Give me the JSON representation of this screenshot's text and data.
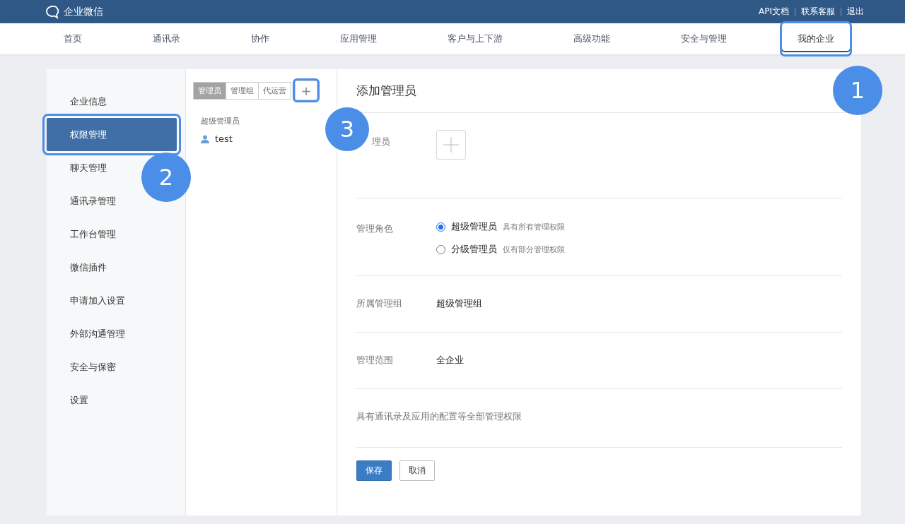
{
  "header": {
    "logo": "企业微信",
    "links": [
      "API文档",
      "联系客服",
      "退出"
    ]
  },
  "nav": [
    {
      "label": "首页",
      "selected": false,
      "highlighted": false
    },
    {
      "label": "通讯录",
      "selected": false,
      "highlighted": false
    },
    {
      "label": "协作",
      "selected": false,
      "highlighted": false
    },
    {
      "label": "应用管理",
      "selected": false,
      "highlighted": false
    },
    {
      "label": "客户与上下游",
      "selected": false,
      "highlighted": false
    },
    {
      "label": "高级功能",
      "selected": false,
      "highlighted": false
    },
    {
      "label": "安全与管理",
      "selected": false,
      "highlighted": false
    },
    {
      "label": "我的企业",
      "selected": true,
      "highlighted": true
    }
  ],
  "sidebar": {
    "items": [
      {
        "label": "企业信息",
        "selected": false,
        "highlighted": false
      },
      {
        "label": "权限管理",
        "selected": true,
        "highlighted": true
      },
      {
        "label": "聊天管理",
        "selected": false,
        "highlighted": false
      },
      {
        "label": "通讯录管理",
        "selected": false,
        "highlighted": false
      },
      {
        "label": "工作台管理",
        "selected": false,
        "highlighted": false
      },
      {
        "label": "微信插件",
        "selected": false,
        "highlighted": false
      },
      {
        "label": "申请加入设置",
        "selected": false,
        "highlighted": false
      },
      {
        "label": "外部沟通管理",
        "selected": false,
        "highlighted": false
      },
      {
        "label": "安全与保密",
        "selected": false,
        "highlighted": false
      },
      {
        "label": "设置",
        "selected": false,
        "highlighted": false
      }
    ]
  },
  "admin_list": {
    "tabs": [
      {
        "label": "管理员",
        "selected": true
      },
      {
        "label": "管理组",
        "selected": false
      },
      {
        "label": "代运营",
        "selected": false
      }
    ],
    "add_button": {
      "label": "+",
      "highlighted": true
    },
    "group_title": "超级管理员",
    "members": [
      "test"
    ]
  },
  "form": {
    "title": "添加管理员",
    "admin_label": "理员",
    "role_label": "管理角色",
    "roles": [
      {
        "name": "超级管理员",
        "hint": "具有所有管理权限",
        "selected": true
      },
      {
        "name": "分级管理员",
        "hint": "仅有部分管理权限",
        "selected": false
      }
    ],
    "group_label": "所属管理组",
    "group_value": "超级管理组",
    "scope_label": "管理范围",
    "scope_value": "全企业",
    "description": "具有通讯录及应用的配置等全部管理权限",
    "buttons": {
      "save": "保存",
      "cancel": "取消"
    }
  },
  "annotations": [
    "1",
    "2",
    "3"
  ]
}
